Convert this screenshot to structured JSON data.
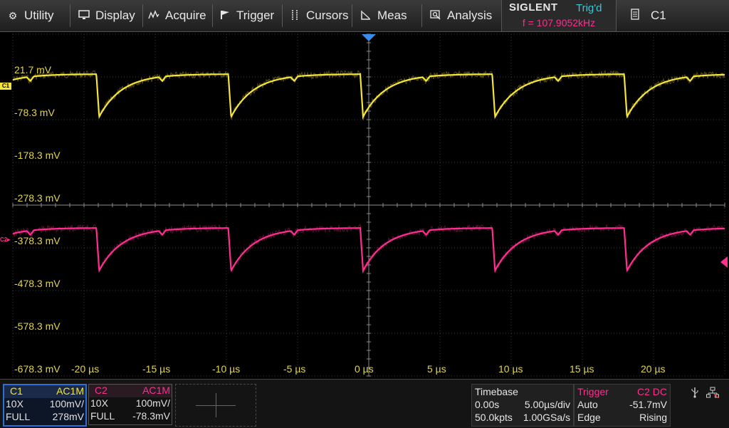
{
  "menu": {
    "utility": "Utility",
    "display": "Display",
    "acquire": "Acquire",
    "trigger": "Trigger",
    "cursors": "Cursors",
    "meas": "Meas",
    "analysis": "Analysis"
  },
  "header": {
    "brand": "SIGLENT",
    "trig_status": "Trig'd",
    "frequency": "f = 107.9052kHz",
    "active_channel": "C1"
  },
  "plot": {
    "ch1_marker": "C1",
    "ch2_marker": "C2",
    "y_labels": [
      "21.7 mV",
      "-78.3 mV",
      "-178.3 mV",
      "-278.3 mV",
      "-378.3 mV",
      "-478.3 mV",
      "-578.3 mV",
      "-678.3 mV"
    ],
    "x_labels": [
      "-20 µs",
      "-15 µs",
      "-10 µs",
      "-5 µs",
      "0 µs",
      "5 µs",
      "10 µs",
      "15 µs",
      "20 µs"
    ]
  },
  "colors": {
    "ch1": "#f5e53a",
    "ch2": "#ff2e8f",
    "trig_status": "#38c8d6",
    "label_text": "#e3d54b"
  },
  "channels": {
    "c1": {
      "name": "C1",
      "coupling": "AC1M",
      "probe": "10X",
      "scale": "100mV/",
      "bw": "FULL",
      "offset": "278mV"
    },
    "c2": {
      "name": "C2",
      "coupling": "AC1M",
      "probe": "10X",
      "scale": "100mV/",
      "bw": "FULL",
      "offset": "-78.3mV"
    }
  },
  "timebase": {
    "title": "Timebase",
    "delay": "0.00s",
    "scale": "5.00µs/div",
    "memory": "50.0kpts",
    "sample_rate": "1.00GSa/s"
  },
  "trigger_panel": {
    "title": "Trigger",
    "source": "C2 DC",
    "mode": "Auto",
    "level": "-51.7mV",
    "type": "Edge",
    "slope": "Rising"
  },
  "icons": {
    "utility": "gear-icon",
    "display": "monitor-icon",
    "acquire": "acquire-icon",
    "trigger": "flag-icon",
    "cursors": "cursor-icon",
    "meas": "ruler-icon",
    "analysis": "analysis-icon",
    "channel_select": "list-icon",
    "usb": "usb-icon",
    "network": "network-icon"
  },
  "waveform": {
    "period_us": 9.2675,
    "fall_time_us": 0.2,
    "recovery_tau_us": 1.6,
    "amplitude_mv": 100
  }
}
